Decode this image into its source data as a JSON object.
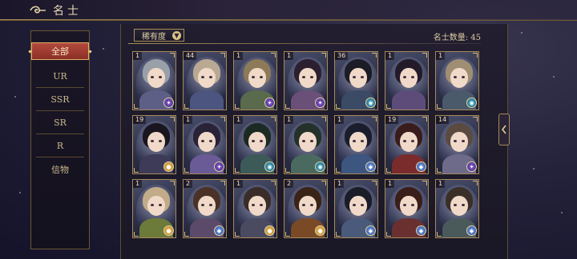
{
  "header": {
    "title": "名士"
  },
  "sidebar": {
    "items": [
      {
        "label": "全部",
        "active": true
      },
      {
        "label": "UR"
      },
      {
        "label": "SSR"
      },
      {
        "label": "SR"
      },
      {
        "label": "R"
      },
      {
        "label": "信物"
      }
    ]
  },
  "toolbar": {
    "sort_label": "稀有度"
  },
  "summary": {
    "count_text": "名士数量: 45"
  },
  "icons": {
    "back": "ornate-back-icon",
    "expand": "chevron-left-icon",
    "sort": "chevron-down-icon"
  },
  "colors": {
    "accent_gold": "#a88f58",
    "active_red": "#9c3a30"
  },
  "cards": [
    {
      "level": "1",
      "badge": "purple",
      "hair": "#9aa0a8",
      "body": "#5e5f86"
    },
    {
      "level": "44",
      "badge": "",
      "hair": "#b9a992",
      "body": "#4c5580"
    },
    {
      "level": "1",
      "badge": "purple",
      "hair": "#8c7a58",
      "body": "#5a6a4c"
    },
    {
      "level": "1",
      "badge": "purple",
      "hair": "#2c2030",
      "body": "#6a4f78"
    },
    {
      "level": "36",
      "badge": "teal",
      "hair": "#1c1c26",
      "body": "#3b4b66"
    },
    {
      "level": "1",
      "badge": "",
      "hair": "#241b2a",
      "body": "#5d4c7a"
    },
    {
      "level": "1",
      "badge": "teal",
      "hair": "#9f8e74",
      "body": "#4a5a6a"
    },
    {
      "level": "19",
      "badge": "gold",
      "hair": "#1a1620",
      "body": "#3e3b58"
    },
    {
      "level": "1",
      "badge": "purple",
      "hair": "#2a2236",
      "body": "#6a5a96"
    },
    {
      "level": "1",
      "badge": "teal",
      "hair": "#1b2a22",
      "body": "#3c5a58"
    },
    {
      "level": "1",
      "badge": "teal",
      "hair": "#24302a",
      "body": "#4a6a60"
    },
    {
      "level": "1",
      "badge": "blue",
      "hair": "#1a1e2c",
      "body": "#3c5680"
    },
    {
      "level": "19",
      "badge": "blue",
      "hair": "#3a1c1c",
      "body": "#7a2c2c"
    },
    {
      "level": "14",
      "badge": "purple",
      "hair": "#5a4a40",
      "body": "#6e6a8a"
    },
    {
      "level": "1",
      "badge": "gold",
      "hair": "#c2ab88",
      "body": "#6c7a3a"
    },
    {
      "level": "2",
      "badge": "blue",
      "hair": "#4a3226",
      "body": "#5c4a6a"
    },
    {
      "level": "1",
      "badge": "gold",
      "hair": "#3a2c28",
      "body": "#4a4a60"
    },
    {
      "level": "2",
      "badge": "gold",
      "hair": "#3a2418",
      "body": "#7a4a26"
    },
    {
      "level": "1",
      "badge": "blue",
      "hair": "#1a1c28",
      "body": "#4a5a7a"
    },
    {
      "level": "1",
      "badge": "blue",
      "hair": "#3a1e1a",
      "body": "#6a3030"
    },
    {
      "level": "1",
      "badge": "blue",
      "hair": "#3a3028",
      "body": "#4a5a5a"
    }
  ]
}
